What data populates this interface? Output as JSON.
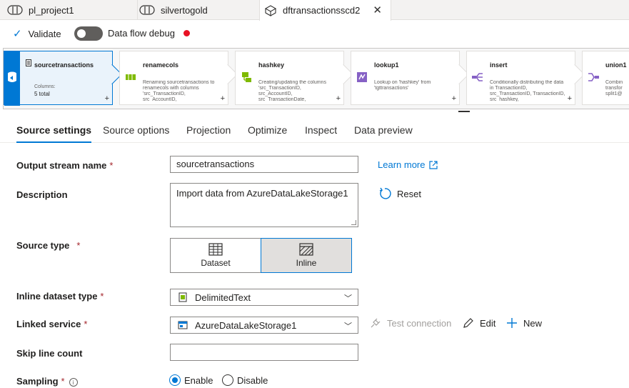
{
  "tabs": [
    {
      "label": "pl_project1",
      "icon": "pipeline-icon"
    },
    {
      "label": "silvertogold",
      "icon": "pipeline-icon"
    },
    {
      "label": "dftransactionsscd2",
      "icon": "dataflow-icon",
      "active": true
    }
  ],
  "toolbar": {
    "validate_label": "Validate",
    "debug_label": "Data flow debug",
    "debug_on": false,
    "debug_status_color": "#e81123"
  },
  "pipeline": {
    "nodes": [
      {
        "title": "sourcetransactions",
        "columns_label": "Columns:",
        "columns_value": "5 total",
        "icon": "source-icon"
      },
      {
        "title": "renamecols",
        "description": "Renaming sourcetransactions to renamecols with columns 'src_TransactionID, src_AccountID,",
        "icon": "select-icon"
      },
      {
        "title": "hashkey",
        "description": "Creating/updating the columns 'src_TransactionID, src_AccountID, src_TransactionDate,",
        "icon": "derived-column-icon"
      },
      {
        "title": "lookup1",
        "description": "Lookup on 'hashkey' from 'tgttransactions'",
        "icon": "lookup-icon"
      },
      {
        "title": "insert",
        "description": "Conditionally distributing the data in TransactionID, src_TransactionID, TransactionID, src_hashkey,",
        "icon": "conditional-split-icon"
      },
      {
        "title": "union1",
        "description": "Combin transfor split1@",
        "icon": "union-icon"
      }
    ],
    "add_glyph": "+"
  },
  "settings_tabs": [
    "Source settings",
    "Source options",
    "Projection",
    "Optimize",
    "Inspect",
    "Data preview"
  ],
  "form": {
    "output_stream": {
      "label": "Output stream name",
      "value": "sourcetransactions"
    },
    "learn_more": "Learn more",
    "description": {
      "label": "Description",
      "value": "Import data from AzureDataLakeStorage1"
    },
    "reset": "Reset",
    "source_type": {
      "label": "Source type",
      "options": [
        "Dataset",
        "Inline"
      ],
      "selected": "Inline"
    },
    "inline_dataset_type": {
      "label": "Inline dataset type",
      "value": "DelimitedText"
    },
    "linked_service": {
      "label": "Linked service",
      "value": "AzureDataLakeStorage1"
    },
    "test_connection": "Test connection",
    "edit": "Edit",
    "new": "New",
    "skip_line_count": {
      "label": "Skip line count",
      "value": ""
    },
    "sampling": {
      "label": "Sampling",
      "options": [
        "Enable",
        "Disable"
      ],
      "selected": "Enable"
    },
    "required_mark": "*",
    "info_glyph": "i"
  },
  "colors": {
    "accent": "#0078d4",
    "required": "#a4262c"
  }
}
